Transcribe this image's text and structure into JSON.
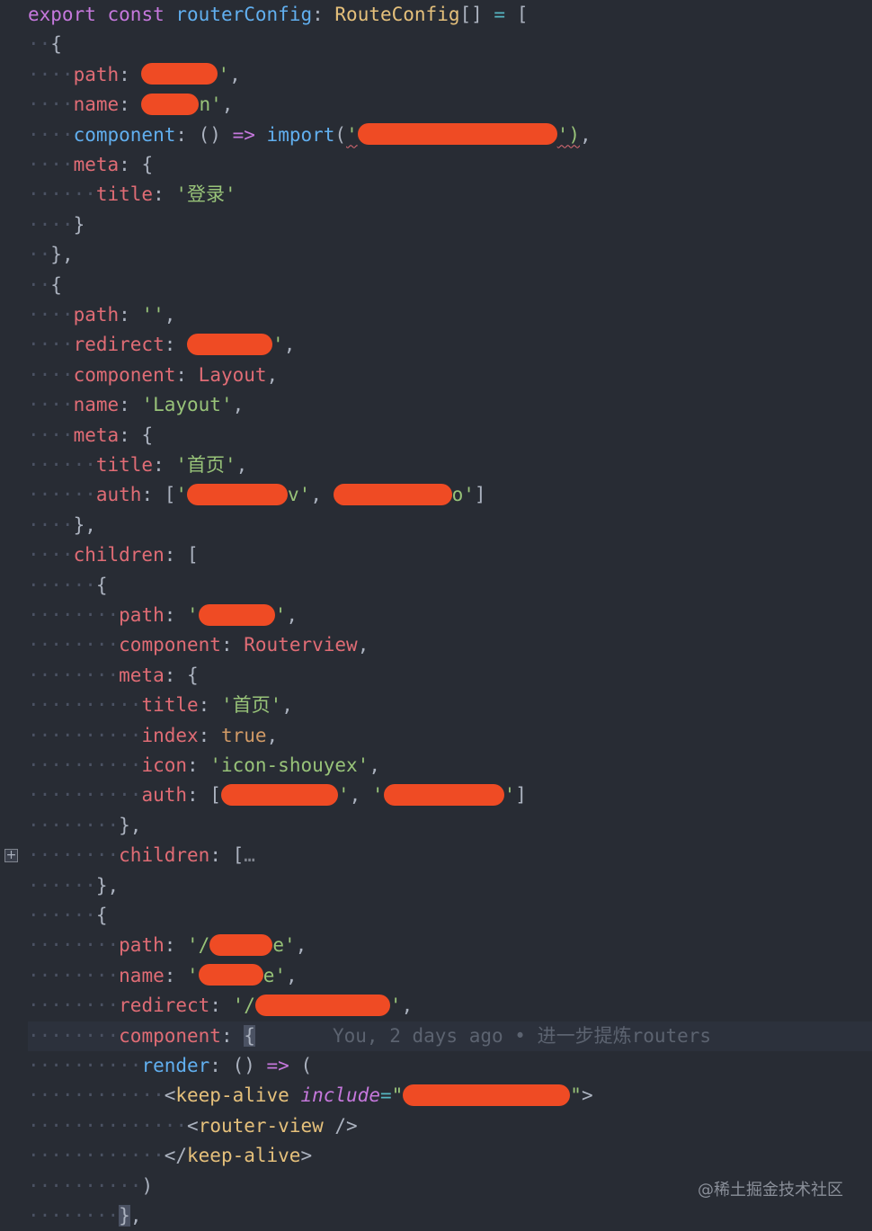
{
  "editor": {
    "lines": [
      {
        "current": false,
        "tokens": [
          {
            "t": "export",
            "c": "kw"
          },
          {
            "t": " ",
            "c": "pun"
          },
          {
            "t": "const",
            "c": "kw"
          },
          {
            "t": " ",
            "c": "pun"
          },
          {
            "t": "routerConfig",
            "c": "fn"
          },
          {
            "t": ": ",
            "c": "pun"
          },
          {
            "t": "RouteConfig",
            "c": "ty"
          },
          {
            "t": "[] ",
            "c": "pun"
          },
          {
            "t": "=",
            "c": "op"
          },
          {
            "t": " [",
            "c": "pun"
          }
        ]
      },
      {
        "indent": 1,
        "tokens": [
          {
            "t": "{",
            "c": "pun"
          }
        ]
      },
      {
        "indent": 2,
        "tokens": [
          {
            "t": "path",
            "c": "prop"
          },
          {
            "t": ": ",
            "c": "pun"
          },
          {
            "r": 85
          },
          {
            "t": "'",
            "c": "str"
          },
          {
            "t": ",",
            "c": "pun"
          }
        ]
      },
      {
        "indent": 2,
        "tokens": [
          {
            "t": "name",
            "c": "prop"
          },
          {
            "t": ": ",
            "c": "pun"
          },
          {
            "r": 64
          },
          {
            "t": "n'",
            "c": "str"
          },
          {
            "t": ",",
            "c": "pun"
          }
        ]
      },
      {
        "indent": 2,
        "tokens": [
          {
            "t": "component",
            "c": "fn"
          },
          {
            "t": ": () ",
            "c": "pun"
          },
          {
            "t": "=>",
            "c": "kw"
          },
          {
            "t": " ",
            "c": "pun"
          },
          {
            "t": "import",
            "c": "fn"
          },
          {
            "t": "(",
            "c": "pun"
          },
          {
            "t": "'",
            "c": "str sq"
          },
          {
            "r": 222,
            "sq": true
          },
          {
            "t": "')",
            "c": "str sq2"
          },
          {
            "t": ",",
            "c": "pun"
          }
        ]
      },
      {
        "indent": 2,
        "tokens": [
          {
            "t": "meta",
            "c": "prop"
          },
          {
            "t": ": {",
            "c": "pun"
          }
        ]
      },
      {
        "indent": 3,
        "tokens": [
          {
            "t": "title",
            "c": "prop"
          },
          {
            "t": ": ",
            "c": "pun"
          },
          {
            "t": "'登录'",
            "c": "str"
          }
        ]
      },
      {
        "indent": 2,
        "tokens": [
          {
            "t": "}",
            "c": "pun"
          }
        ]
      },
      {
        "indent": 1,
        "tokens": [
          {
            "t": "},",
            "c": "pun"
          }
        ]
      },
      {
        "indent": 1,
        "tokens": [
          {
            "t": "{",
            "c": "pun"
          }
        ]
      },
      {
        "indent": 2,
        "tokens": [
          {
            "t": "path",
            "c": "prop"
          },
          {
            "t": ": ",
            "c": "pun"
          },
          {
            "t": "''",
            "c": "str"
          },
          {
            "t": ",",
            "c": "pun"
          }
        ]
      },
      {
        "indent": 2,
        "tokens": [
          {
            "t": "redirect",
            "c": "prop"
          },
          {
            "t": ": ",
            "c": "pun"
          },
          {
            "r": 95
          },
          {
            "t": "'",
            "c": "str"
          },
          {
            "t": ",",
            "c": "pun"
          }
        ]
      },
      {
        "indent": 2,
        "tokens": [
          {
            "t": "component",
            "c": "prop"
          },
          {
            "t": ": ",
            "c": "pun"
          },
          {
            "t": "Layout",
            "c": "prop"
          },
          {
            "t": ",",
            "c": "pun"
          }
        ]
      },
      {
        "indent": 2,
        "tokens": [
          {
            "t": "name",
            "c": "prop"
          },
          {
            "t": ": ",
            "c": "pun"
          },
          {
            "t": "'Layout'",
            "c": "str"
          },
          {
            "t": ",",
            "c": "pun"
          }
        ]
      },
      {
        "indent": 2,
        "tokens": [
          {
            "t": "meta",
            "c": "prop"
          },
          {
            "t": ": {",
            "c": "pun"
          }
        ]
      },
      {
        "indent": 3,
        "tokens": [
          {
            "t": "title",
            "c": "prop"
          },
          {
            "t": ": ",
            "c": "pun"
          },
          {
            "t": "'首页'",
            "c": "str"
          },
          {
            "t": ",",
            "c": "pun"
          }
        ]
      },
      {
        "indent": 3,
        "tokens": [
          {
            "t": "auth",
            "c": "prop"
          },
          {
            "t": ": [",
            "c": "pun"
          },
          {
            "t": "'",
            "c": "str"
          },
          {
            "r": 112
          },
          {
            "t": "v'",
            "c": "str"
          },
          {
            "t": ", ",
            "c": "pun"
          },
          {
            "r": 132
          },
          {
            "t": "o'",
            "c": "str"
          },
          {
            "t": "]",
            "c": "pun"
          }
        ]
      },
      {
        "indent": 2,
        "tokens": [
          {
            "t": "},",
            "c": "pun"
          }
        ]
      },
      {
        "indent": 2,
        "tokens": [
          {
            "t": "children",
            "c": "prop"
          },
          {
            "t": ": [",
            "c": "pun"
          }
        ]
      },
      {
        "indent": 3,
        "tokens": [
          {
            "t": "{",
            "c": "pun"
          }
        ]
      },
      {
        "indent": 4,
        "tokens": [
          {
            "t": "path",
            "c": "prop"
          },
          {
            "t": ": ",
            "c": "pun"
          },
          {
            "t": "'",
            "c": "str"
          },
          {
            "r": 85
          },
          {
            "t": "'",
            "c": "str"
          },
          {
            "t": ",",
            "c": "pun"
          }
        ]
      },
      {
        "indent": 4,
        "tokens": [
          {
            "t": "component",
            "c": "prop"
          },
          {
            "t": ": ",
            "c": "pun"
          },
          {
            "t": "Routerview",
            "c": "prop"
          },
          {
            "t": ",",
            "c": "pun"
          }
        ]
      },
      {
        "indent": 4,
        "tokens": [
          {
            "t": "meta",
            "c": "prop"
          },
          {
            "t": ": {",
            "c": "pun"
          }
        ]
      },
      {
        "indent": 5,
        "tokens": [
          {
            "t": "title",
            "c": "prop"
          },
          {
            "t": ": ",
            "c": "pun"
          },
          {
            "t": "'首页'",
            "c": "str"
          },
          {
            "t": ",",
            "c": "pun"
          }
        ]
      },
      {
        "indent": 5,
        "tokens": [
          {
            "t": "index",
            "c": "prop"
          },
          {
            "t": ": ",
            "c": "pun"
          },
          {
            "t": "true",
            "c": "num"
          },
          {
            "t": ",",
            "c": "pun"
          }
        ]
      },
      {
        "indent": 5,
        "tokens": [
          {
            "t": "icon",
            "c": "prop"
          },
          {
            "t": ": ",
            "c": "pun"
          },
          {
            "t": "'icon-shouyex'",
            "c": "str"
          },
          {
            "t": ",",
            "c": "pun"
          }
        ]
      },
      {
        "indent": 5,
        "tokens": [
          {
            "t": "auth",
            "c": "prop"
          },
          {
            "t": ": [",
            "c": "pun"
          },
          {
            "r": 130
          },
          {
            "t": "'",
            "c": "str"
          },
          {
            "t": ", ",
            "c": "pun"
          },
          {
            "t": "'",
            "c": "str"
          },
          {
            "r": 134
          },
          {
            "t": "'",
            "c": "str"
          },
          {
            "t": "]",
            "c": "pun"
          }
        ]
      },
      {
        "indent": 4,
        "tokens": [
          {
            "t": "},",
            "c": "pun"
          }
        ]
      },
      {
        "indent": 4,
        "tokens": [
          {
            "t": "children",
            "c": "prop"
          },
          {
            "t": ": [",
            "c": "pun"
          },
          {
            "t": "…",
            "c": "fold-mark"
          }
        ]
      },
      {
        "indent": 3,
        "tokens": [
          {
            "t": "},",
            "c": "pun"
          }
        ]
      },
      {
        "indent": 3,
        "tokens": [
          {
            "t": "{",
            "c": "pun"
          }
        ]
      },
      {
        "indent": 4,
        "tokens": [
          {
            "t": "path",
            "c": "prop"
          },
          {
            "t": ": ",
            "c": "pun"
          },
          {
            "t": "'/",
            "c": "str"
          },
          {
            "r": 70
          },
          {
            "t": "e'",
            "c": "str"
          },
          {
            "t": ",",
            "c": "pun"
          }
        ]
      },
      {
        "indent": 4,
        "tokens": [
          {
            "t": "name",
            "c": "prop"
          },
          {
            "t": ": ",
            "c": "pun"
          },
          {
            "t": "'",
            "c": "str"
          },
          {
            "r": 72
          },
          {
            "t": "e'",
            "c": "str"
          },
          {
            "t": ",",
            "c": "pun"
          }
        ]
      },
      {
        "indent": 4,
        "tokens": [
          {
            "t": "redirect",
            "c": "prop"
          },
          {
            "t": ": ",
            "c": "pun"
          },
          {
            "t": "'/",
            "c": "str"
          },
          {
            "r": 150
          },
          {
            "t": "'",
            "c": "str"
          },
          {
            "t": ",",
            "c": "pun"
          }
        ]
      },
      {
        "indent": 4,
        "current": true,
        "tokens": [
          {
            "t": "component",
            "c": "prop"
          },
          {
            "t": ": ",
            "c": "pun"
          },
          {
            "t": "{",
            "c": "pun cursor-box"
          }
        ]
      },
      {
        "indent": 5,
        "tokens": [
          {
            "t": "render",
            "c": "fn"
          },
          {
            "t": ": () ",
            "c": "pun"
          },
          {
            "t": "=>",
            "c": "kw"
          },
          {
            "t": " (",
            "c": "pun"
          }
        ]
      },
      {
        "indent": 6,
        "tokens": [
          {
            "t": "<",
            "c": "pun"
          },
          {
            "t": "keep-alive",
            "c": "ty"
          },
          {
            "t": " ",
            "c": "pun"
          },
          {
            "t": "include",
            "c": "attr"
          },
          {
            "t": "=",
            "c": "op"
          },
          {
            "t": "\"",
            "c": "str"
          },
          {
            "r": 186
          },
          {
            "t": "\"",
            "c": "str"
          },
          {
            "t": ">",
            "c": "pun"
          }
        ]
      },
      {
        "indent": 7,
        "tokens": [
          {
            "t": "<",
            "c": "pun"
          },
          {
            "t": "router-view",
            "c": "ty"
          },
          {
            "t": " />",
            "c": "pun"
          }
        ]
      },
      {
        "indent": 6,
        "tokens": [
          {
            "t": "</",
            "c": "pun"
          },
          {
            "t": "keep-alive",
            "c": "ty"
          },
          {
            "t": ">",
            "c": "pun"
          }
        ]
      },
      {
        "indent": 5,
        "tokens": [
          {
            "t": ")",
            "c": "pun"
          }
        ]
      },
      {
        "indent": 4,
        "tokens": [
          {
            "t": "}",
            "c": "pun cursor-box"
          },
          {
            "t": ",",
            "c": "pun"
          }
        ]
      }
    ],
    "blame": "You, 2 days ago • 进一步提炼routers",
    "blame_line": 34,
    "fold_button_label": "+",
    "fold_line": 28
  },
  "watermark": "@稀土掘金技术社区",
  "colors": {
    "background": "#282c34",
    "redaction": "#ef4b24",
    "keyword": "#c678dd",
    "function": "#61afef",
    "type": "#e5c07b",
    "string": "#98c379",
    "property": "#e06c75"
  }
}
